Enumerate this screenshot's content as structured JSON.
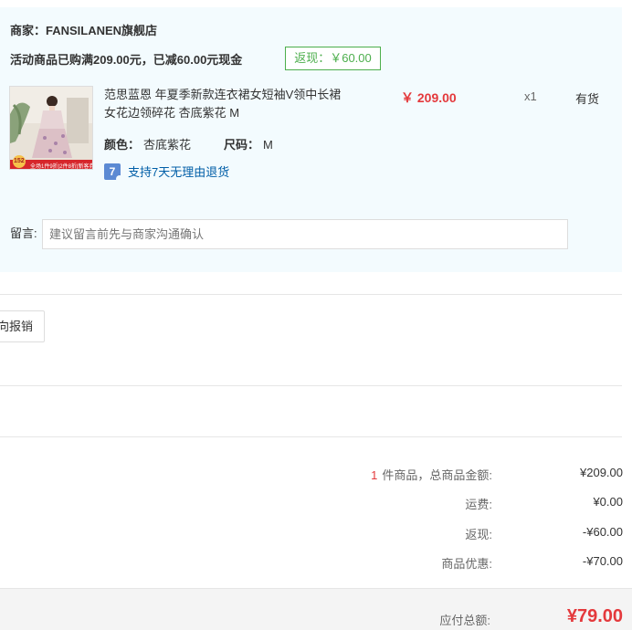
{
  "merchant": {
    "name": "商家：FANSILANEN旗舰店",
    "promo": "活动商品已购满209.00元，已减60.00元现金",
    "rebate_tag": "返现：￥60.00"
  },
  "product": {
    "title_line1": "范思蓝恩 年夏季新款连衣裙女短袖V领中长裙",
    "title_line2": "女花边领碎花 杏底紫花 M",
    "price": "￥ 209.00",
    "qty": "x1",
    "stock": "有货",
    "color_label": "颜色：",
    "color_value": "杏底紫花",
    "size_label": "尺码：",
    "size_value": "M",
    "return_badge": "7",
    "return_text": "支持7天无理由退货",
    "thumb_badge": "152",
    "thumb_banner": "全场1件9折|2件8折|新客券"
  },
  "remark": {
    "label": "留言:",
    "placeholder": "建议留言前先与商家沟通确认"
  },
  "invoice": {
    "button_label": "向报销"
  },
  "summary": {
    "count": "1",
    "items_label": "件商品，总商品金额:",
    "items_value": "¥209.00",
    "shipping_label": "运费:",
    "shipping_value": "¥0.00",
    "rebate_label": "返现:",
    "rebate_value": "-¥60.00",
    "discount_label": "商品优惠:",
    "discount_value": "-¥70.00",
    "total_label": "应付总额:",
    "total_value": "¥79.00"
  },
  "colors": {
    "accent_red": "#e4393c",
    "rebate_green": "#4cae4c",
    "panel_bg": "#f3fbfe",
    "link_blue": "#005ea7"
  }
}
